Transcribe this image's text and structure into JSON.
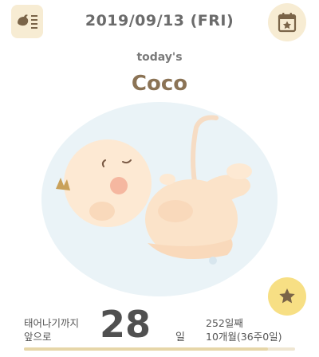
{
  "header": {
    "date": "2019/09/13 (FRI)",
    "menu_icon": "baby-list-icon",
    "calendar_icon": "calendar-star-icon"
  },
  "baby": {
    "todays_label": "today's",
    "name": "Coco"
  },
  "countdown": {
    "until_line1": "태어나기까지",
    "until_line2": "앞으로",
    "days": "28",
    "days_unit": "일",
    "day_count": "252일째",
    "week_info": "10개월(36주0일)",
    "progress_fraction": 0.9
  },
  "favorite_icon": "star-icon",
  "colors": {
    "accent_beige": "#f7ecd3",
    "star_yellow": "#f7df84",
    "name_brown": "#8b7355"
  }
}
